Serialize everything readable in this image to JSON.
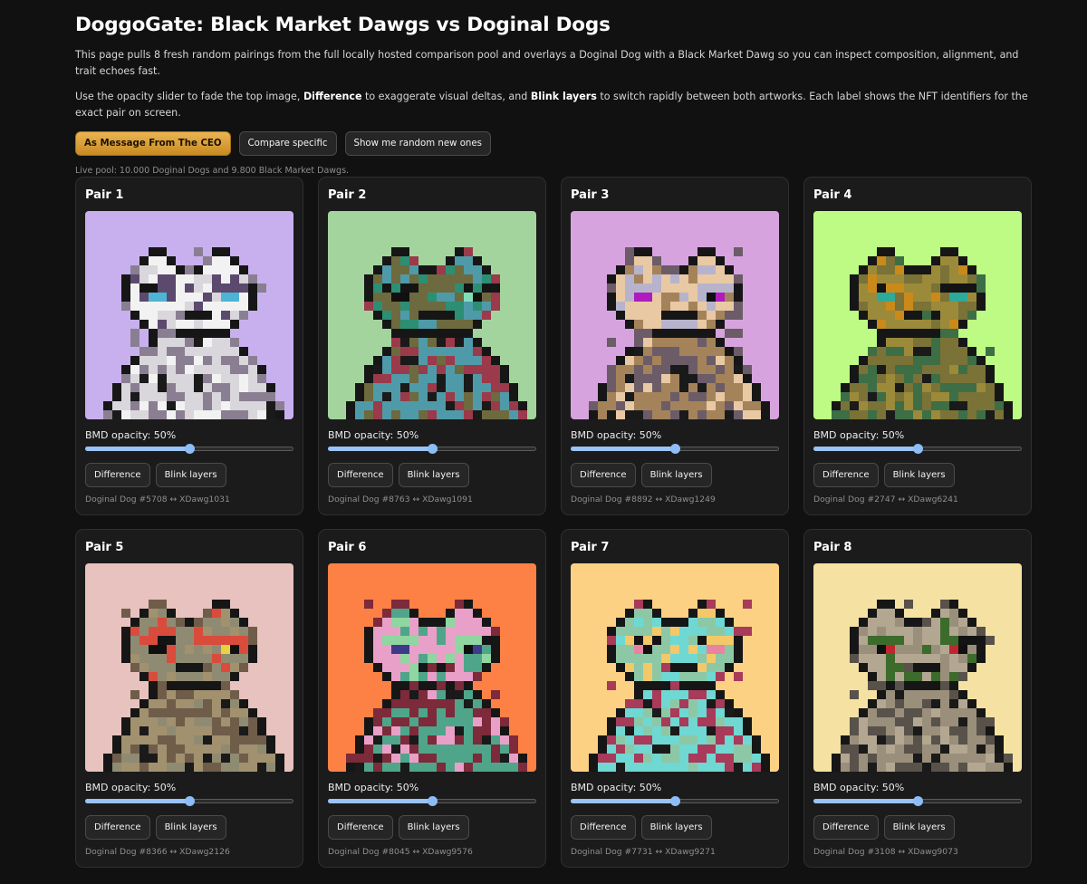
{
  "header": {
    "title": "DoggoGate: Black Market Dawgs vs Doginal Dogs",
    "intro_1": "This page pulls 8 fresh random pairings from the full locally hosted comparison pool and overlays a Doginal Dog with a Black Market Dawg so you can inspect composition, alignment, and trait echoes fast.",
    "intro_2_a": "Use the opacity slider to fade the top image, ",
    "intro_2_b": "Difference",
    "intro_2_c": " to exaggerate visual deltas, and ",
    "intro_2_d": "Blink layers",
    "intro_2_e": " to switch rapidly between both artworks. Each label shows the NFT identifiers for the exact pair on screen."
  },
  "actions": {
    "ceo_label": "As Message From The CEO",
    "compare_label": "Compare specific",
    "random_label": "Show me random new ones"
  },
  "pool_text": "Live pool: 10.000 Doginal Dogs and 9.800 Black Market Dawgs.",
  "card_labels": {
    "opacity_prefix": "BMD opacity: ",
    "difference": "Difference",
    "blink": "Blink layers"
  },
  "pairs": [
    {
      "title": "Pair 1",
      "opacity_label": "50%",
      "opacity": 0.5,
      "ids": "Doginal Dog #5708 ↔ XDawg1031",
      "bg": "#c8b0ee",
      "body": "#d9d6dc",
      "body2": "#8a7f92",
      "head": "#f2f2f2",
      "accent": "#5b4a6e",
      "eye": "#4db4d6"
    },
    {
      "title": "Pair 2",
      "opacity_label": "50%",
      "opacity": 0.5,
      "ids": "Doginal Dog #8763 ↔ XDawg1091",
      "bg": "#a4d49d",
      "body": "#4f9aa8",
      "body2": "#9a3a4a",
      "head": "#6d6a3f",
      "accent": "#2c8f74",
      "eye": "#7fe0b8"
    },
    {
      "title": "Pair 3",
      "opacity_label": "50%",
      "opacity": 0.5,
      "ids": "Doginal Dog #8892 ↔ XDawg1249",
      "bg": "#d7a3de",
      "body": "#a5835a",
      "body2": "#6b5c68",
      "head": "#e9c9a4",
      "accent": "#b8b3cc",
      "eye": "#b01bbf"
    },
    {
      "title": "Pair 4",
      "opacity_label": "50%",
      "opacity": 0.5,
      "ids": "Doginal Dog #2747 ↔ XDawg6241",
      "bg": "#befb84",
      "body": "#7a7236",
      "body2": "#3d6e45",
      "head": "#9b8a3a",
      "accent": "#c98a1a",
      "eye": "#2ea99a"
    },
    {
      "title": "Pair 5",
      "opacity_label": "50%",
      "opacity": 0.5,
      "ids": "Doginal Dog #8366 ↔ XDawg2126",
      "bg": "#e8c2be",
      "body": "#a2916e",
      "body2": "#6f5d4a",
      "head": "#8f8b72",
      "accent": "#d94c3b",
      "eye": "#e8d23f"
    },
    {
      "title": "Pair 6",
      "opacity_label": "50%",
      "opacity": 0.5,
      "ids": "Doginal Dog #8045 ↔ XDawg9576",
      "bg": "#fd8144",
      "body": "#4fa58a",
      "body2": "#7d2a3a",
      "head": "#e9a0c8",
      "accent": "#8fd6a0",
      "eye": "#3f3a8c"
    },
    {
      "title": "Pair 7",
      "opacity_label": "50%",
      "opacity": 0.5,
      "ids": "Doginal Dog #7731 ↔ XDawg9271",
      "bg": "#fcd183",
      "body": "#6fd8d2",
      "body2": "#a83a5a",
      "head": "#8cc8a6",
      "accent": "#f3c869",
      "eye": "#e883a0"
    },
    {
      "title": "Pair 8",
      "opacity_label": "50%",
      "opacity": 0.5,
      "ids": "Doginal Dog #3108 ↔ XDawg9073",
      "bg": "#f5e2a2",
      "body": "#9a8f7a",
      "body2": "#58524a",
      "head": "#b3a792",
      "accent": "#3c6b2c",
      "eye": "#c0262f"
    }
  ]
}
